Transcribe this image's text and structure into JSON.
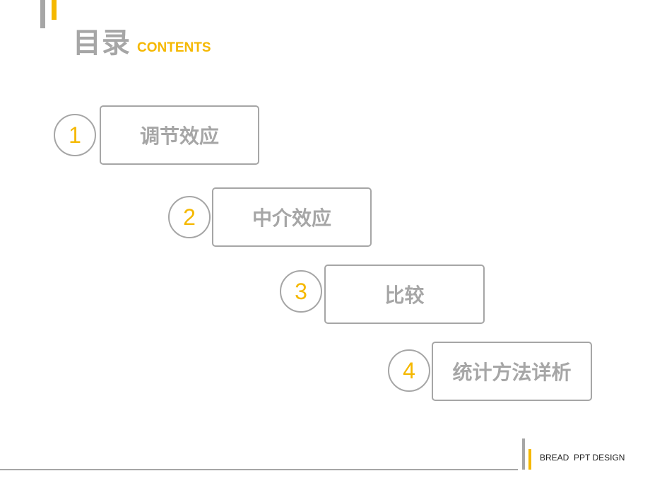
{
  "header": {
    "title": "目录",
    "subtitle": "CONTENTS"
  },
  "items": [
    {
      "number": "1",
      "label": "调节效应"
    },
    {
      "number": "2",
      "label": "中介效应"
    },
    {
      "number": "3",
      "label": "比较"
    },
    {
      "number": "4",
      "label": "统计方法详析"
    }
  ],
  "footer": {
    "brand": "BREAD  PPT DESIGN"
  },
  "colors": {
    "accent": "#f5b800",
    "gray": "#a6a6a6"
  }
}
